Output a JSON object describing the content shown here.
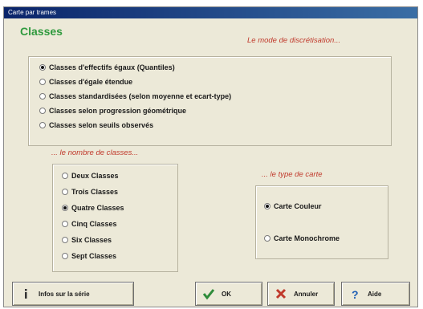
{
  "window": {
    "title": "Carte par trames"
  },
  "header": {
    "title": "Classes"
  },
  "discretization": {
    "label": "Le mode de discrétisation...",
    "selected_index": 0,
    "options": [
      "Classes d'effectifs égaux (Quantiles)",
      "Classes d'égale étendue",
      "Classes standardisées (selon moyenne et ecart-type)",
      "Classes selon progression géométrique",
      "Classes selon seuils observés"
    ]
  },
  "class_count": {
    "label": "... le nombre de classes...",
    "selected_index": 2,
    "options": [
      "Deux Classes",
      "Trois Classes",
      "Quatre Classes",
      "Cinq Classes",
      "Six Classes",
      "Sept Classes"
    ]
  },
  "map_type": {
    "label": "... le type de carte",
    "selected_index": 0,
    "options": [
      "Carte Couleur",
      "Carte Monochrome"
    ]
  },
  "buttons": {
    "info": "Infos sur la série",
    "ok": "OK",
    "cancel": "Annuler",
    "help": "Aide"
  },
  "colors": {
    "title_green": "#2f9a3e",
    "label_red": "#c0392b",
    "ok_green": "#2e8b3a",
    "cancel_red": "#c0392b",
    "help_blue": "#1f5fb5"
  },
  "icons": {
    "info": "info-icon",
    "ok": "checkmark-icon",
    "cancel": "x-icon",
    "help": "question-icon"
  }
}
